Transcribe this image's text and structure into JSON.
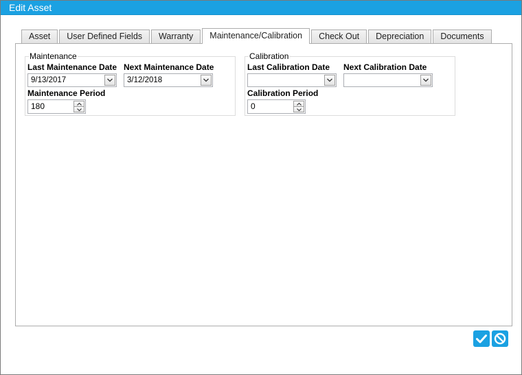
{
  "window": {
    "title": "Edit Asset"
  },
  "tabs": [
    {
      "label": "Asset",
      "active": false
    },
    {
      "label": "User Defined Fields",
      "active": false
    },
    {
      "label": "Warranty",
      "active": false
    },
    {
      "label": "Maintenance/Calibration",
      "active": true
    },
    {
      "label": "Check Out",
      "active": false
    },
    {
      "label": "Depreciation",
      "active": false
    },
    {
      "label": "Documents",
      "active": false
    }
  ],
  "maintenance": {
    "title": "Maintenance",
    "last_date_label": "Last Maintenance Date",
    "last_date_value": "9/13/2017",
    "next_date_label": "Next Maintenance Date",
    "next_date_value": "3/12/2018",
    "period_label": "Maintenance Period",
    "period_value": "180"
  },
  "calibration": {
    "title": "Calibration",
    "last_date_label": "Last Calibration Date",
    "last_date_value": "",
    "next_date_label": "Next Calibration Date",
    "next_date_value": "",
    "period_label": "Calibration Period",
    "period_value": "0"
  },
  "actions": {
    "save_icon": "checkmark-icon",
    "cancel_icon": "cancel-icon",
    "accent_color": "#1ba1e2"
  }
}
